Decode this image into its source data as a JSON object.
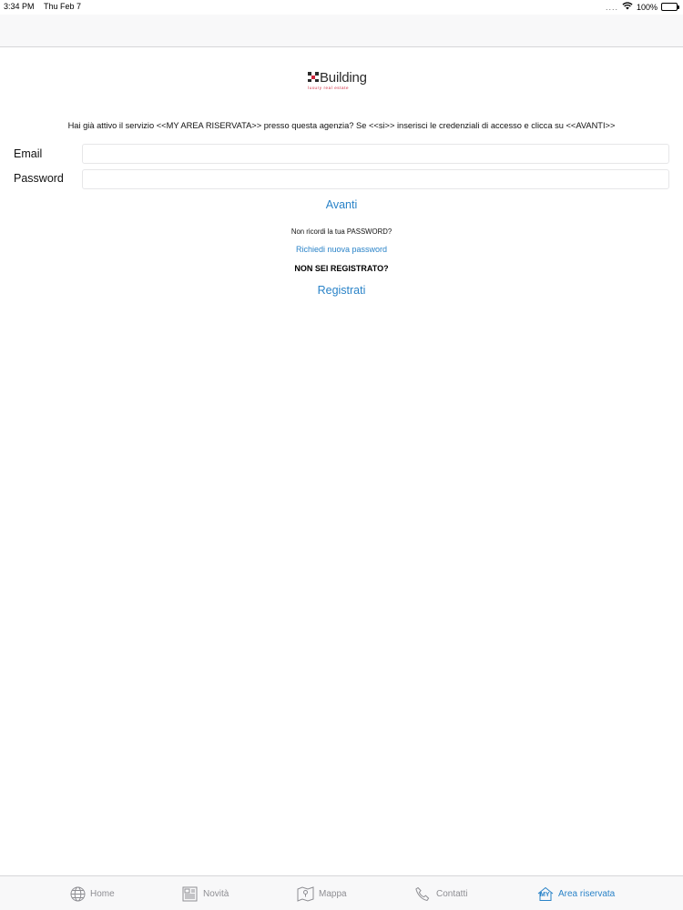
{
  "status_bar": {
    "time": "3:34 PM",
    "date": "Thu Feb 7",
    "signal_dots": "....",
    "battery": "100%"
  },
  "logo": {
    "mark": "✖",
    "text": "Building",
    "tagline": "luxury  real  estate",
    "mark_color": "#2b2b2b",
    "tagline_color": "#d0263c"
  },
  "intro_text": "Hai già attivo il servizio <<MY AREA RISERVATA>> presso questa agenzia? Se <<si>> inserisci le credenziali di accesso e clicca su <<AVANTI>>",
  "form": {
    "email_label": "Email",
    "email_value": "",
    "email_placeholder": "",
    "password_label": "Password",
    "password_value": "",
    "password_placeholder": ""
  },
  "actions": {
    "avanti": "Avanti",
    "forgot_text": "Non ricordi la tua PASSWORD?",
    "request_password": "Richiedi nuova password",
    "not_registered": "NON SEI REGISTRATO?",
    "register": "Registrati"
  },
  "tabs": [
    {
      "label": "Home",
      "icon": "globe-icon"
    },
    {
      "label": "Novità",
      "icon": "newspaper-icon"
    },
    {
      "label": "Mappa",
      "icon": "map-icon"
    },
    {
      "label": "Contatti",
      "icon": "phone-icon"
    },
    {
      "label": "Area riservata",
      "icon": "my-area-icon",
      "badge": "MY",
      "active": true
    }
  ],
  "colors": {
    "accent": "#2a83c8",
    "inactive_tab": "#8e8e93",
    "bar_background": "#f8f8f9"
  }
}
